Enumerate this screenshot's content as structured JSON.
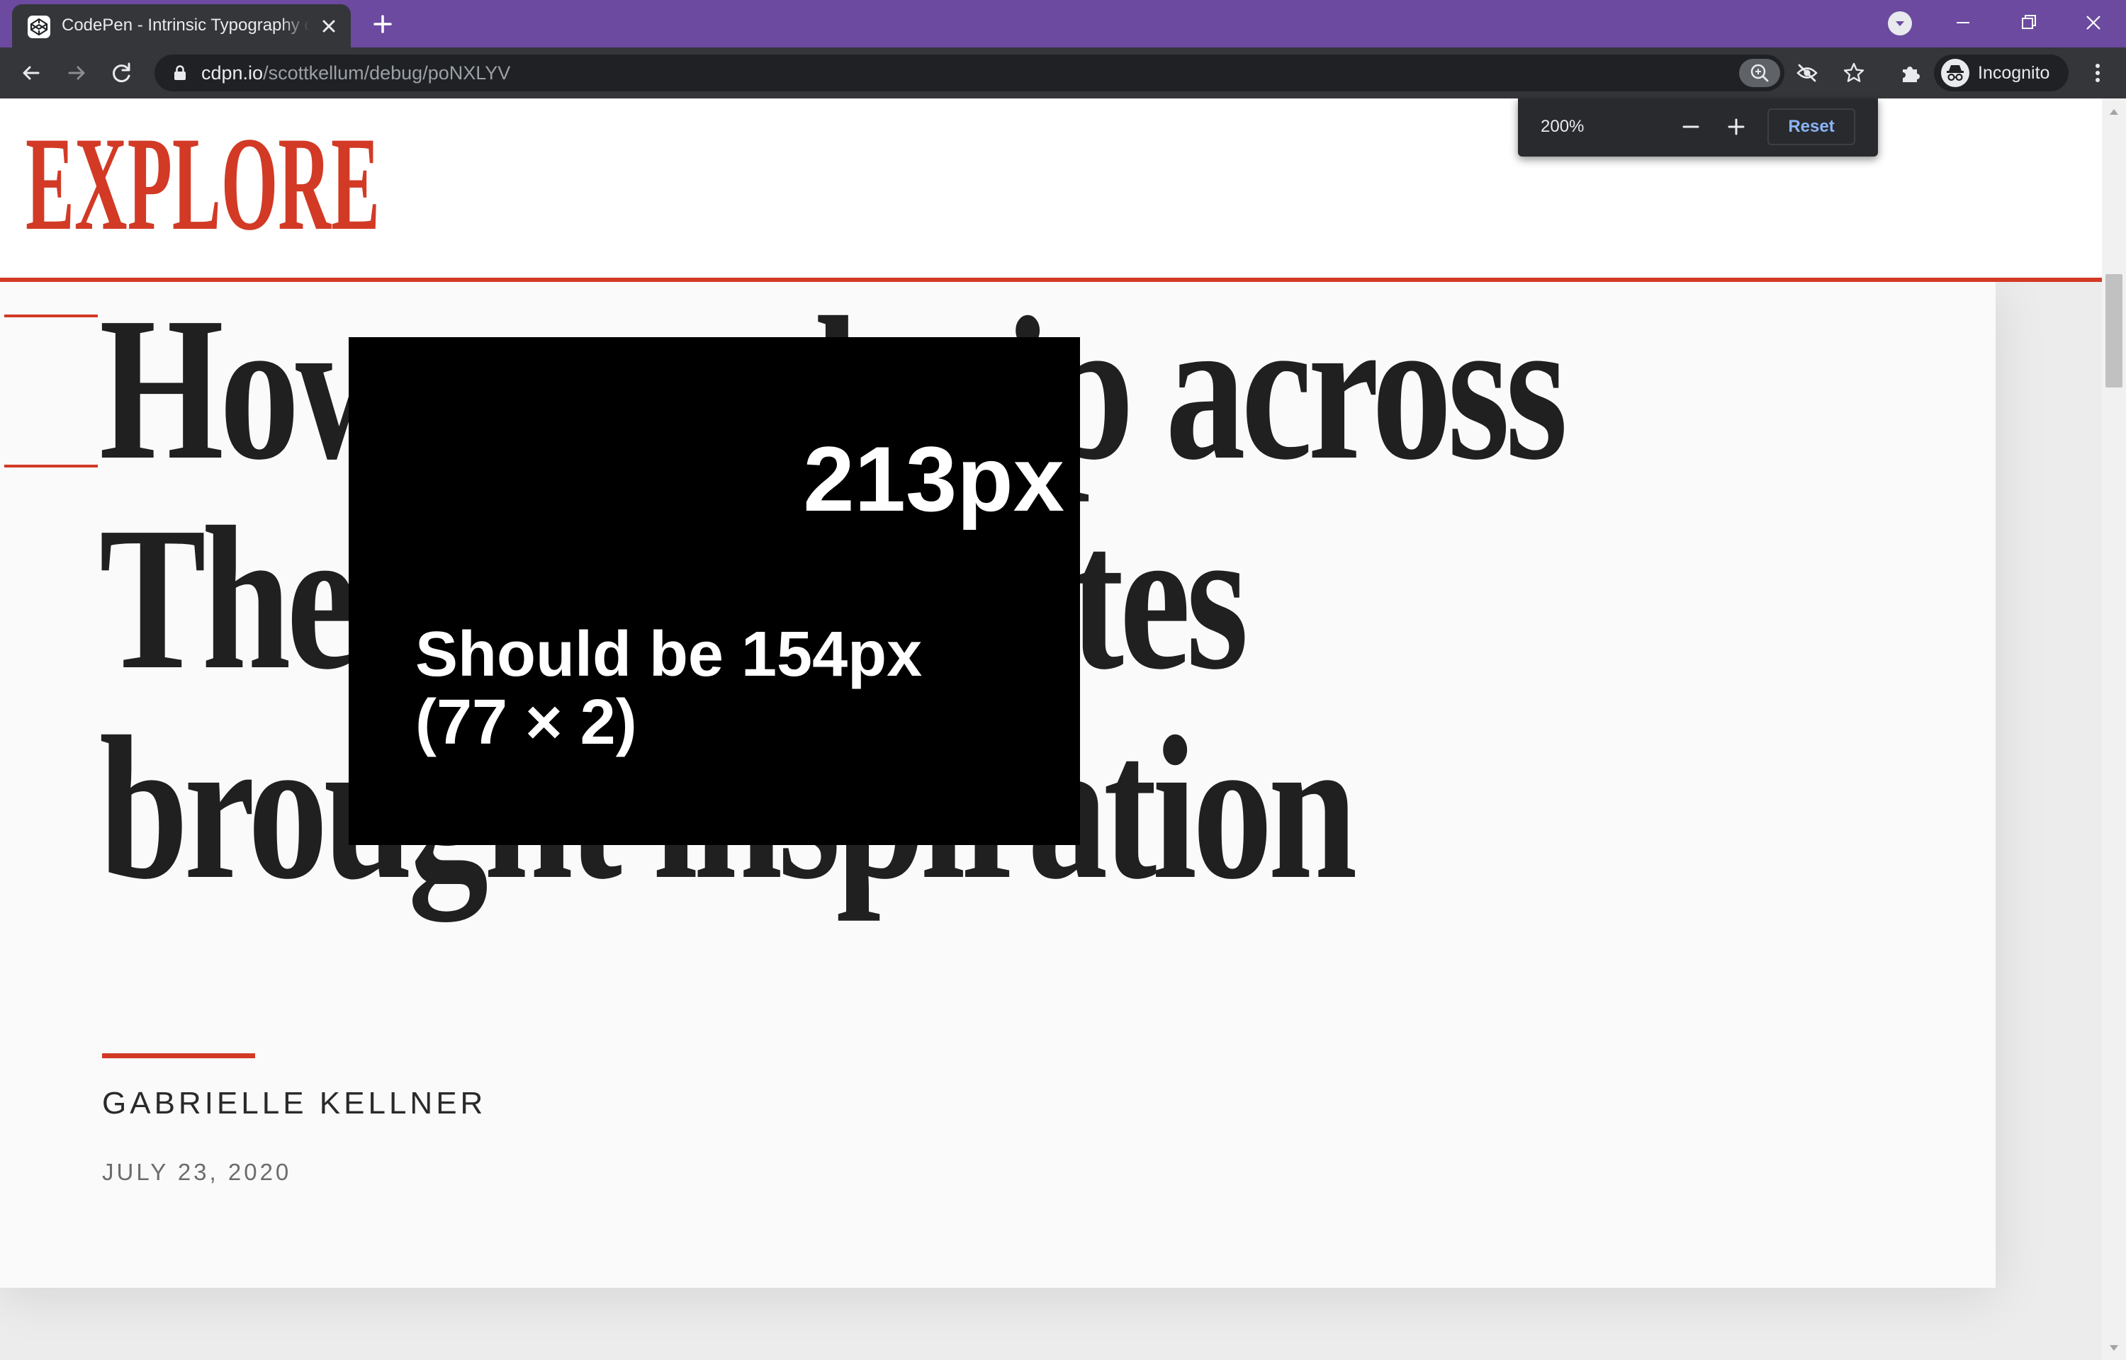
{
  "browser": {
    "tab": {
      "title": "CodePen - Intrinsic Typography d",
      "favicon": "codepen-icon"
    },
    "url": {
      "host": "cdpn.io",
      "path": "/scottkellum/debug/poNXLYV"
    },
    "profile_label": "Incognito",
    "icons": [
      "back-arrow-icon",
      "forward-arrow-icon",
      "reload-icon",
      "lock-icon",
      "zoom-icon",
      "eye-off-icon",
      "star-icon",
      "puzzle-icon",
      "incognito-icon",
      "kebab-menu-icon"
    ]
  },
  "zoom_bubble": {
    "level": "200%",
    "reset_label": "Reset"
  },
  "page": {
    "logo_text": "EXPLORE",
    "headline_lines": [
      "How a road trip across",
      "The United States",
      "brought inspiration"
    ],
    "author": "GABRIELLE KELLNER",
    "date": "JULY 23, 2020",
    "overlay": {
      "measured": "213px",
      "expected_line1": "Should be 154px",
      "expected_line2": "(77 × 2)"
    }
  },
  "colors": {
    "tabstrip": "#6b4aa0",
    "toolbar": "#35363a",
    "accent_red": "#d23a25",
    "headline_text": "#202020",
    "reset_link": "#8ab4f8"
  }
}
